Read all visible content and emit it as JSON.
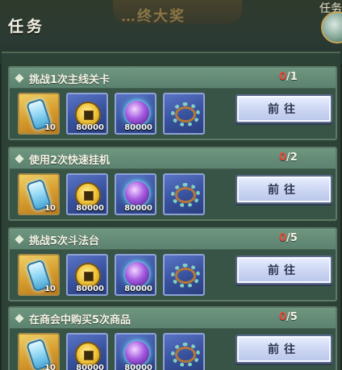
{
  "header": {
    "title": "任务",
    "banner_text": "…终大奖",
    "corner_text": "任务"
  },
  "tasks": [
    {
      "title": "挑战1次主线关卡",
      "progress_current": "0",
      "progress_total": "/1",
      "button_label": "前往",
      "rewards": [
        {
          "icon": "crystal-icon",
          "count": "10"
        },
        {
          "icon": "copper-coin-icon",
          "count": "80000"
        },
        {
          "icon": "spirit-orb-icon",
          "count": "80000"
        },
        {
          "icon": "jade-bracelet-icon",
          "count": ""
        }
      ]
    },
    {
      "title": "使用2次快速挂机",
      "progress_current": "0",
      "progress_total": "/2",
      "button_label": "前往",
      "rewards": [
        {
          "icon": "crystal-icon",
          "count": "10"
        },
        {
          "icon": "copper-coin-icon",
          "count": "80000"
        },
        {
          "icon": "spirit-orb-icon",
          "count": "80000"
        },
        {
          "icon": "jade-bracelet-icon",
          "count": ""
        }
      ]
    },
    {
      "title": "挑战5次斗法台",
      "progress_current": "0",
      "progress_total": "/5",
      "button_label": "前往",
      "rewards": [
        {
          "icon": "crystal-icon",
          "count": "10"
        },
        {
          "icon": "copper-coin-icon",
          "count": "80000"
        },
        {
          "icon": "spirit-orb-icon",
          "count": "80000"
        },
        {
          "icon": "jade-bracelet-icon",
          "count": ""
        }
      ]
    },
    {
      "title": "在商会中购买5次商品",
      "progress_current": "0",
      "progress_total": "/5",
      "button_label": "前往",
      "rewards": [
        {
          "icon": "crystal-icon",
          "count": "10"
        },
        {
          "icon": "copper-coin-icon",
          "count": "80000"
        },
        {
          "icon": "spirit-orb-icon",
          "count": "80000"
        },
        {
          "icon": "jade-bracelet-icon",
          "count": ""
        }
      ]
    }
  ],
  "colors": {
    "progress_current": "#e84a3a",
    "panel": "#2c4237",
    "button": "#cfd9f4"
  }
}
